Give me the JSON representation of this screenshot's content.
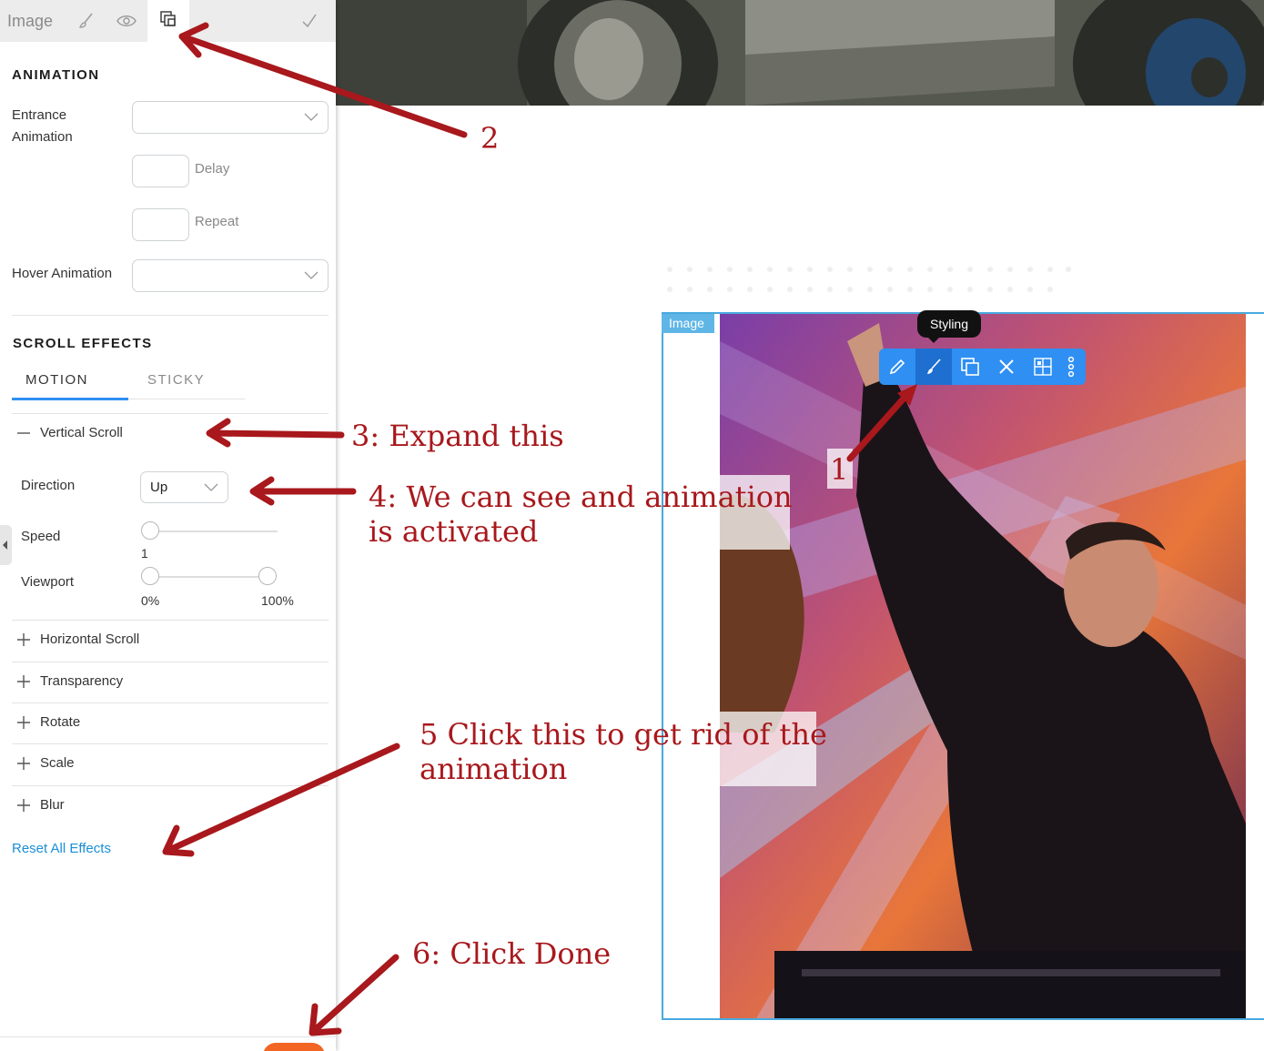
{
  "panel": {
    "tabs": {
      "title": "Image"
    },
    "animation": {
      "heading": "ANIMATION",
      "entrance_label": "Entrance\nAnimation",
      "entrance_value": "",
      "delay_label": "Delay",
      "delay_value": "",
      "repeat_label": "Repeat",
      "repeat_value": "",
      "hover_label": "Hover Animation",
      "hover_value": ""
    },
    "scroll_effects": {
      "heading": "SCROLL EFFECTS",
      "subtabs": [
        {
          "label": "MOTION",
          "active": true
        },
        {
          "label": "STICKY",
          "active": false
        }
      ],
      "vertical_scroll": {
        "label": "Vertical Scroll",
        "direction_label": "Direction",
        "direction_value": "Up",
        "speed_label": "Speed",
        "speed_value": "1",
        "viewport_label": "Viewport",
        "viewport_min": "0%",
        "viewport_max": "100%"
      },
      "collapsed": [
        {
          "label": "Horizontal Scroll"
        },
        {
          "label": "Transparency"
        },
        {
          "label": "Rotate"
        },
        {
          "label": "Scale"
        },
        {
          "label": "Blur"
        }
      ],
      "reset_label": "Reset All Effects"
    }
  },
  "canvas": {
    "element_tag": "Image",
    "tooltip": "Styling",
    "toolbar_icons": [
      "pencil-icon",
      "brush-icon",
      "animation-icon",
      "close-icon",
      "layout-icon",
      "more-icon"
    ]
  },
  "annotations": {
    "step1": "1",
    "step2": "2",
    "step3": "3: Expand this",
    "step4": "4: We can see and animation\nis activated",
    "step5": "5 Click this to get rid of the\nanimation",
    "step6": "6: Click Done"
  },
  "colors": {
    "accent_blue": "#2f8ff3",
    "link_blue": "#1a8fd6",
    "annotation_red": "#a8181c",
    "done_orange": "#f26522",
    "frame_blue": "#48a9de"
  }
}
